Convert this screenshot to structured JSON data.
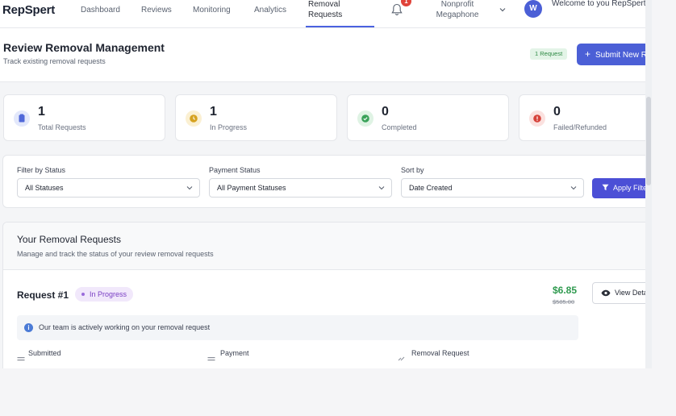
{
  "nav": {
    "logo": "RepSpert",
    "links": [
      "Dashboard",
      "Reviews",
      "Monitoring",
      "Analytics"
    ],
    "active": "Removal Requests",
    "notification_count": "1",
    "org": "Nonprofit Megaphone",
    "avatar": "W",
    "welcome": "Welcome to you RepSpert Portal!"
  },
  "header": {
    "title": "Review Removal Management",
    "subtitle": "Track existing removal requests",
    "request_badge": "1 Request",
    "submit_label": "Submit New Request"
  },
  "stats": [
    {
      "value": "1",
      "label": "Total Requests",
      "bg": "#e3e8fb",
      "dot": "#5068d9"
    },
    {
      "value": "1",
      "label": "In Progress",
      "bg": "#fbf0d2",
      "dot": "#d6a21f"
    },
    {
      "value": "0",
      "label": "Completed",
      "bg": "#dff3e4",
      "dot": "#3aa259"
    },
    {
      "value": "0",
      "label": "Failed/Refunded",
      "bg": "#fbe1df",
      "dot": "#d6423a"
    }
  ],
  "filters": {
    "status_label": "Filter by Status",
    "status_value": "All Statuses",
    "payment_label": "Payment Status",
    "payment_value": "All Payment Statuses",
    "sort_label": "Sort by",
    "sort_value": "Date Created",
    "apply_label": "Apply Filters"
  },
  "requests": {
    "title": "Your Removal Requests",
    "subtitle": "Manage and track the status of your review removal requests",
    "items": [
      {
        "name": "Request #1",
        "status": "In Progress",
        "price": "$6.85",
        "original_price": "$585.00",
        "view_label": "View Details",
        "info": "Our team is actively working on your removal request",
        "columns": [
          "Submitted",
          "Payment",
          "Removal Request"
        ]
      }
    ]
  }
}
